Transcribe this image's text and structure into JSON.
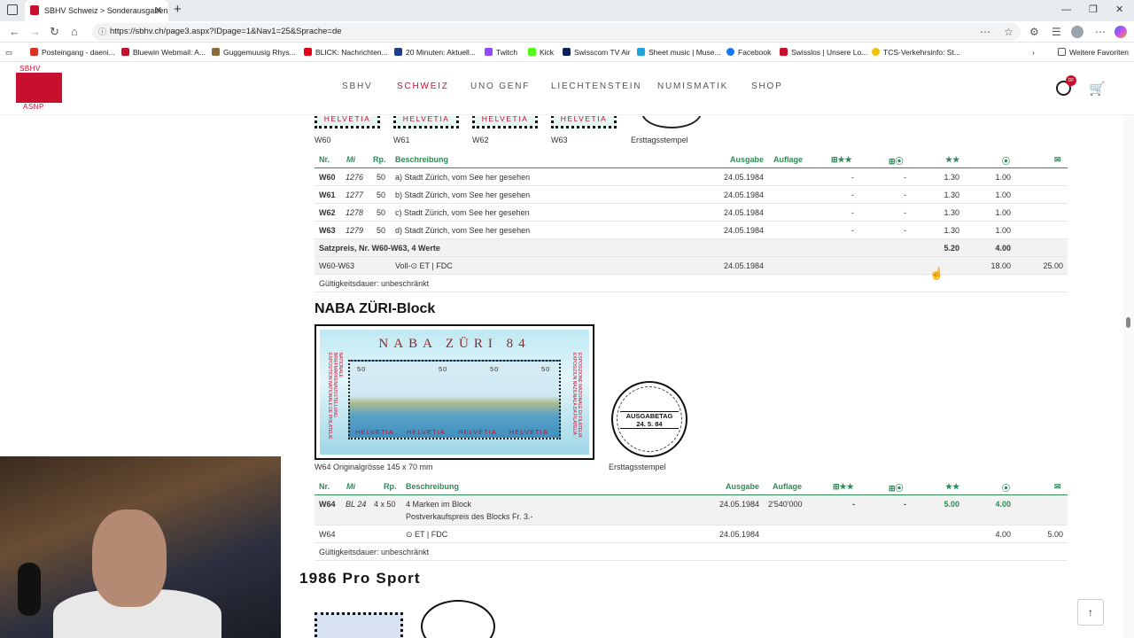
{
  "browser": {
    "tab_title": "SBHV Schweiz > Sonderausgaben",
    "tab_close": "✕",
    "new_tab": "+",
    "url": "https://sbhv.ch/page3.aspx?IDpage=1&Nav1=25&Sprache=de",
    "window": {
      "minimize": "—",
      "maximize": "❐",
      "close": "✕"
    },
    "bookmarks": [
      {
        "label": "Posteingang - daeni...",
        "color": "#d93025"
      },
      {
        "label": "Bluewin Webmail: A...",
        "color": "#c8102e"
      },
      {
        "label": "Guggemuusig Rhys...",
        "color": "#8a6d3b"
      },
      {
        "label": "BLICK: Nachrichten...",
        "color": "#e2001a"
      },
      {
        "label": "20 Minuten: Aktuell...",
        "color": "#1a3e8c"
      },
      {
        "label": "Twitch",
        "color": "#9146ff"
      },
      {
        "label": "Kick",
        "color": "#53fc18"
      },
      {
        "label": "Swisscom TV Air",
        "color": "#0a1f5c"
      },
      {
        "label": "Sheet music | Muse...",
        "color": "#1ea3d9"
      },
      {
        "label": "Facebook",
        "color": "#1877f2"
      },
      {
        "label": "Swisslos | Unsere Lo...",
        "color": "#c8102e"
      },
      {
        "label": "TCS-Verkehrsinfo: St...",
        "color": "#f2c200"
      }
    ],
    "more_favorites": "Weitere Favoriten"
  },
  "site": {
    "logo_top": "SBHV",
    "logo_bottom": "ASNP",
    "nav": [
      "SBHV",
      "SCHWEIZ",
      "UNO GENF",
      "LIECHTENSTEIN",
      "NUMISMATIK",
      "SHOP"
    ],
    "active_nav": "SCHWEIZ",
    "user_badge": "DF"
  },
  "section1": {
    "stamps": [
      {
        "label": "HELVETIA",
        "caption": "W60"
      },
      {
        "label": "HELVETIA",
        "caption": "W61"
      },
      {
        "label": "HELVETIA",
        "caption": "W62"
      },
      {
        "label": "HELVETIA",
        "caption": "W63"
      }
    ],
    "postmark_caption": "Ersttagsstempel",
    "headers": {
      "nr": "Nr.",
      "mi": "Mi",
      "rp": "Rp.",
      "desc": "Beschreibung",
      "ausgabe": "Ausgabe",
      "auflage": "Auflage",
      "c1": "⊞★★",
      "c2": "⊞⦿",
      "c3": "★★",
      "c4": "⦿",
      "c5": "✉"
    },
    "rows": [
      {
        "nr": "W60",
        "mi": "1276",
        "rp": "50",
        "desc": "a) Stadt Zürich, vom See her gesehen",
        "ausgabe": "24.05.1984",
        "c1": "-",
        "c2": "-",
        "c3": "1.30",
        "c4": "1.00"
      },
      {
        "nr": "W61",
        "mi": "1277",
        "rp": "50",
        "desc": "b) Stadt Zürich, vom See her gesehen",
        "ausgabe": "24.05.1984",
        "c1": "-",
        "c2": "-",
        "c3": "1.30",
        "c4": "1.00"
      },
      {
        "nr": "W62",
        "mi": "1278",
        "rp": "50",
        "desc": "c) Stadt Zürich, vom See her gesehen",
        "ausgabe": "24.05.1984",
        "c1": "-",
        "c2": "-",
        "c3": "1.30",
        "c4": "1.00"
      },
      {
        "nr": "W63",
        "mi": "1279",
        "rp": "50",
        "desc": "d) Stadt Zürich, vom See her gesehen",
        "ausgabe": "24.05.1984",
        "c1": "-",
        "c2": "-",
        "c3": "1.30",
        "c4": "1.00"
      }
    ],
    "set_row": {
      "label": "Satzpreis, Nr. W60-W63, 4 Werte",
      "c3": "5.20",
      "c4": "4.00"
    },
    "fdc_row": {
      "nr": "W60-W63",
      "desc": "Voll-⊙ ET | FDC",
      "ausgabe": "24.05.1984",
      "c4": "18.00",
      "c5": "25.00"
    },
    "validity": "Gültigkeitsdauer: unbeschränkt"
  },
  "section2": {
    "title": "NABA ZÜRI-Block",
    "block_title": "NABA ZÜRI 84",
    "block_stamp_label": "HELVETIA",
    "block_values": [
      "50",
      "50",
      "50",
      "50"
    ],
    "block_side_left": "NATIONALE BRIEFMARKENAUSSTELLUNG EXPOSITION NATIONALE DE PHILATELIE",
    "block_side_right": "ESPOSIZIONE NAZIONALE DI FILATELIA EXPOSIZIUN NAZIUNALA DA FILATELIA",
    "image_caption": "W64 Originalgrösse 145 x 70 mm",
    "postmark_text1": "AUSGABETAG",
    "postmark_text2": "24. 5. 84",
    "postmark_caption": "Ersttagsstempel",
    "headers": {
      "nr": "Nr.",
      "mi": "Mi",
      "rp": "Rp.",
      "desc": "Beschreibung",
      "ausgabe": "Ausgabe",
      "auflage": "Auflage",
      "c1": "⊞★★",
      "c2": "⊞⦿",
      "c3": "★★",
      "c4": "⦿",
      "c5": "✉"
    },
    "row": {
      "nr": "W64",
      "mi": "BL 24",
      "rp": "4 x 50",
      "desc1": "4 Marken im Block",
      "desc2": "Postverkaufspreis des Blocks Fr. 3.-",
      "ausgabe": "24.05.1984",
      "auflage": "2'540'000",
      "c1": "-",
      "c2": "-",
      "c3": "5.00",
      "c4": "4.00"
    },
    "fdc_row": {
      "nr": "W64",
      "desc": "⊙ ET | FDC",
      "ausgabe": "24.05.1984",
      "c4": "4.00",
      "c5": "5.00"
    },
    "validity": "Gültigkeitsdauer: unbeschränkt"
  },
  "section3": {
    "title": "1986 Pro Sport"
  },
  "back_to_top": "↑"
}
